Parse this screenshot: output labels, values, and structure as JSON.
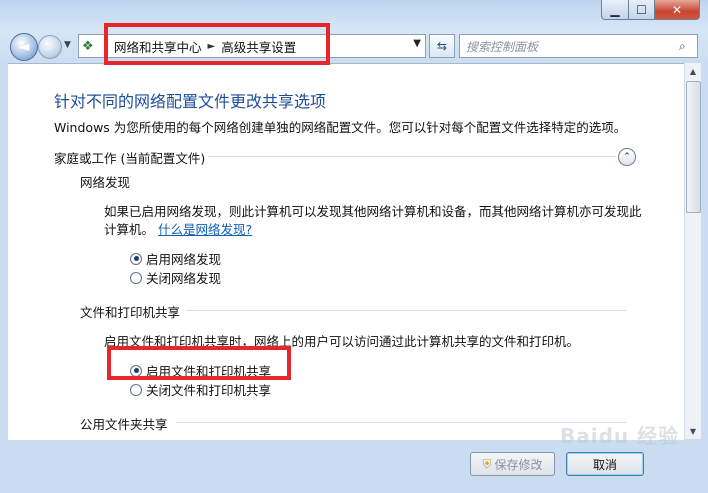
{
  "window": {
    "minimize": "▁",
    "maximize": "☐",
    "close": "✕"
  },
  "nav": {
    "back_icon": "back-arrow-icon",
    "back_glyph": "◄",
    "forward_glyph": "►",
    "history_glyph": "▼",
    "address": {
      "icon": "network-icon",
      "icon_glyph": "❖",
      "sep1": "‹",
      "crumbs": [
        "网络和共享中心",
        "高级共享设置"
      ],
      "sep2": "►",
      "dropdown_glyph": "▼"
    },
    "refresh_glyph": "⇆",
    "search": {
      "placeholder": "搜索控制面板",
      "icon_glyph": "⌕"
    }
  },
  "page": {
    "title": "针对不同的网络配置文件更改共享选项",
    "description": "Windows 为您所使用的每个网络创建单独的网络配置文件。您可以针对每个配置文件选择特定的选项。",
    "profile_header": "家庭或工作 (当前配置文件)",
    "collapse_glyph": "⌃",
    "network_discovery": {
      "heading": "网络发现",
      "text_line1": "如果已启用网络发现，则此计算机可以发现其他网络计算机和设备，而其他网络计算机亦可发现此",
      "text_line2": "计算机。",
      "link": "什么是网络发现?",
      "options": [
        "启用网络发现",
        "关闭网络发现"
      ],
      "selected": 0
    },
    "file_printer_sharing": {
      "heading": "文件和打印机共享",
      "text": "启用文件和打印机共享时，网络上的用户可以访问通过此计算机共享的文件和打印机。",
      "options": [
        "启用文件和打印机共享",
        "关闭文件和打印机共享"
      ],
      "selected": 0
    },
    "public_folder_sharing": {
      "heading": "公用文件夹共享"
    }
  },
  "buttons": {
    "save": "保存修改",
    "cancel": "取消",
    "shield_glyph": "⛨"
  },
  "watermark": "Baidu 经验",
  "colors": {
    "title": "#1e4d9a",
    "link": "#0f5fb3",
    "highlight": "#e5262c"
  }
}
